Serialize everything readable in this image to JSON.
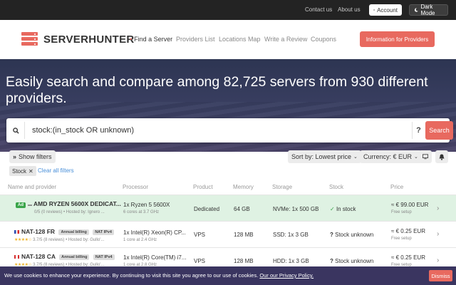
{
  "topbar": {
    "contact": "Contact us",
    "about": "About us",
    "account": "Account",
    "dark_mode": "Dark Mode"
  },
  "header": {
    "logo": "SERVERHUNTER",
    "nav": [
      "Find a Server",
      "Providers List",
      "Locations Map",
      "Write a Review",
      "Coupons"
    ],
    "info_button": "Information for Providers"
  },
  "hero": {
    "title": "Easily search and compare among 82,725 servers from 930 different providers."
  },
  "search": {
    "query": "stock:(in_stock OR unknown)",
    "help": "?",
    "button": "Search"
  },
  "controls": {
    "show_filters": "Show filters",
    "sort": "Sort by: Lowest price",
    "currency": "Currency: € EUR",
    "active_filter": "Stock",
    "clear": "Clear all filters"
  },
  "table": {
    "headers": [
      "Name and provider",
      "Processor",
      "Product",
      "Memory",
      "Storage",
      "Stock",
      "Price"
    ],
    "rows": [
      {
        "ad": "Ad",
        "name": "AMD RYZEN 5600X DEDICAT...",
        "reviews": "0/5 (0 reviews) • Hosted by: Ignero ...",
        "cpu": "1x Ryzen 5 5600X",
        "cpu_sub": "6 cores at 3.7 GHz",
        "product": "Dedicated",
        "memory": "64 GB",
        "storage": "NVMe: 1x 500 GB",
        "stock": "In stock",
        "price": "≈ € 99.00 EUR",
        "setup": "Free setup"
      },
      {
        "name": "NAT-128 FR",
        "badge1": "Annual billing",
        "badge2": "NAT IPv4",
        "reviews": "3.7/5 (8 reviews) • Hosted by: Gullo'...",
        "cpu": "1x Intel(R) Xeon(R) CP...",
        "cpu_sub": "1 core at 2.4 GHz",
        "product": "VPS",
        "memory": "128 MB",
        "storage": "SSD: 1x 3 GB",
        "stock": "Stock unknown",
        "price": "≈ € 0.25 EUR",
        "setup": "Free setup"
      },
      {
        "name": "NAT-128 CA",
        "badge1": "Annual billing",
        "badge2": "NAT IPv4",
        "reviews": "3.7/5 (8 reviews) • Hosted by: Gullo'...",
        "cpu": "1x Intel(R) Core(TM) i7...",
        "cpu_sub": "1 core at 2.8 GHz",
        "product": "VPS",
        "memory": "128 MB",
        "storage": "HDD: 1x 3 GB",
        "stock": "Stock unknown",
        "price": "≈ € 0.25 EUR",
        "setup": "Free setup"
      }
    ]
  },
  "cookie": {
    "text": "We use cookies to enhance your experience. By continuing to visit this site you agree to our use of cookies.",
    "link": "Our our Privacy Policy.",
    "dismiss": "Dismiss"
  },
  "colors": {
    "accent": "#e8695f",
    "topbar": "#232323",
    "hero": "#3a3f62",
    "ad_row": "#dff2e3",
    "in_stock": "#3aa54a"
  }
}
